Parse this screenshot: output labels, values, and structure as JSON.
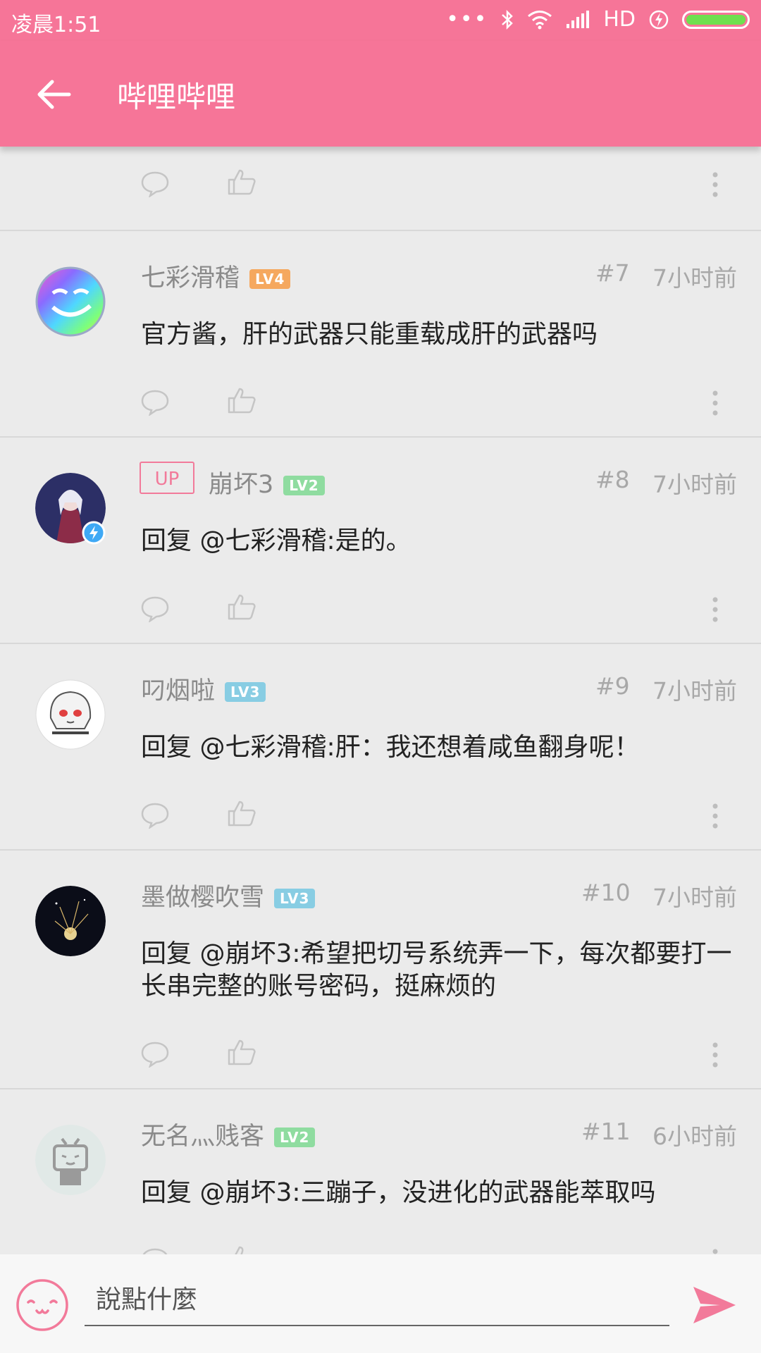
{
  "status_bar": {
    "time": "凌晨1:51",
    "network_label": "HD"
  },
  "app_bar": {
    "title": "哔哩哔哩"
  },
  "comments": [
    {
      "username": "七彩滑稽",
      "level": "LV4",
      "level_color": "#f5a85f",
      "floor": "#7",
      "time": "7小时前",
      "content": "官方酱，肝的武器只能重载成肝的武器吗"
    },
    {
      "badge": "UP",
      "username": "崩坏3",
      "level": "LV2",
      "level_color": "#8fdca0",
      "floor": "#8",
      "time": "7小时前",
      "content": "回复 @七彩滑稽:是的。"
    },
    {
      "username": "叼烟啦",
      "level": "LV3",
      "level_color": "#88cde3",
      "floor": "#9",
      "time": "7小时前",
      "content": "回复 @七彩滑稽:肝：我还想着咸鱼翻身呢！"
    },
    {
      "username": "墨做樱吹雪",
      "level": "LV3",
      "level_color": "#88cde3",
      "floor": "#10",
      "time": "7小时前",
      "content": "回复 @崩坏3:希望把切号系统弄一下，每次都要打一长串完整的账号密码，挺麻烦的"
    },
    {
      "username": "无名灬贱客",
      "level": "LV2",
      "level_color": "#8fdca0",
      "floor": "#11",
      "time": "6小时前",
      "content": "回复 @崩坏3:三蹦子，没进化的武器能萃取吗"
    }
  ],
  "input_bar": {
    "placeholder": "說點什麼"
  }
}
